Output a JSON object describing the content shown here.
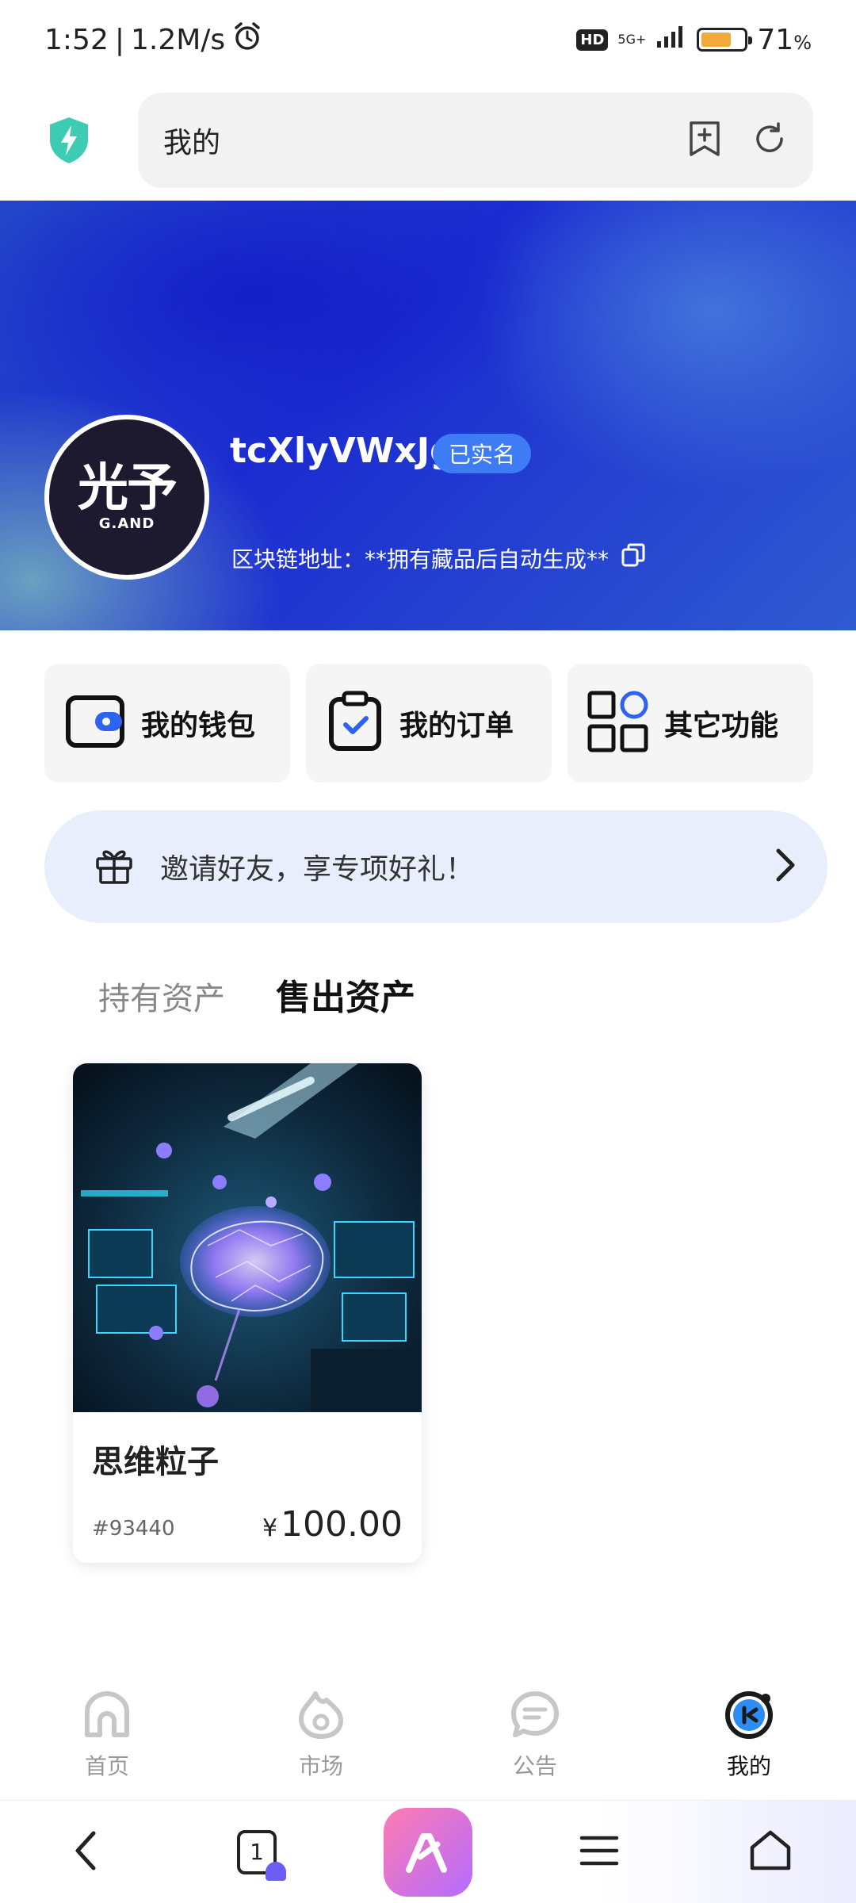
{
  "status_bar": {
    "time": "1:52",
    "speed": "1.2M/s",
    "hd": "HD",
    "network": "5G+",
    "battery_level": 0.71,
    "battery_pct": "71",
    "pct_sign": "%"
  },
  "browser": {
    "address_text": "我的",
    "tab_count": "1"
  },
  "profile": {
    "avatar_main": "光予",
    "avatar_sub": "G.AND",
    "username": "tcXlyVWxJg",
    "verified_badge": "已实名",
    "chain_address": "区块链地址：**拥有藏品后自动生成**"
  },
  "features": [
    {
      "label": "我的钱包",
      "icon": "wallet-icon"
    },
    {
      "label": "我的订单",
      "icon": "clipboard-check-icon"
    },
    {
      "label": "其它功能",
      "icon": "grid-icon"
    }
  ],
  "invite": {
    "text": "邀请好友，享专项好礼！"
  },
  "tabs": [
    {
      "label": "持有资产",
      "active": false
    },
    {
      "label": "售出资产",
      "active": true
    }
  ],
  "assets": [
    {
      "name": "思维粒子",
      "id": "#93440",
      "currency": "¥",
      "price": "100.00"
    }
  ],
  "app_nav": [
    {
      "label": "首页",
      "icon": "home-icon",
      "active": false
    },
    {
      "label": "市场",
      "icon": "market-icon",
      "active": false
    },
    {
      "label": "公告",
      "icon": "announcement-icon",
      "active": false
    },
    {
      "label": "我的",
      "icon": "profile-icon",
      "active": true
    }
  ],
  "colors": {
    "accent": "#3d7cf5",
    "invite_bg": "#e8eefc",
    "battery": "#f2a93b"
  }
}
